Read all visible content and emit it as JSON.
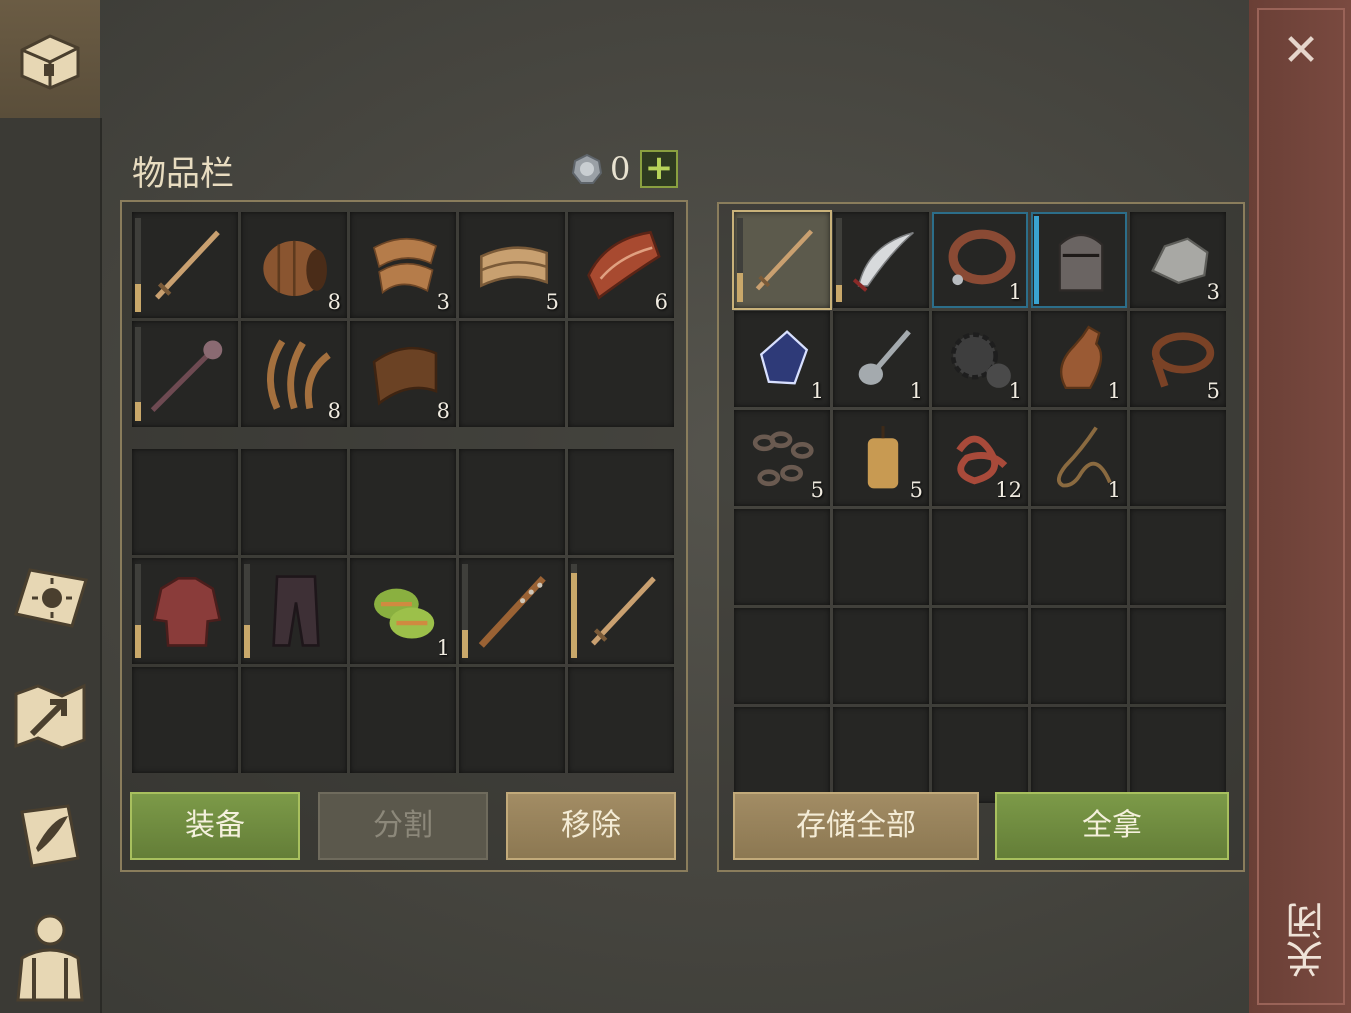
{
  "title": "物品栏",
  "currency": {
    "icon": "silver-coin-icon",
    "count": "0",
    "add_label": "+"
  },
  "inventory_top": [
    {
      "icon": "sword",
      "qty": "",
      "durability": 0.3
    },
    {
      "icon": "barrel",
      "qty": "8"
    },
    {
      "icon": "cloth-roll",
      "qty": "3"
    },
    {
      "icon": "leather-roll",
      "qty": "5"
    },
    {
      "icon": "raw-meat",
      "qty": "6"
    },
    {
      "icon": "mace-spear",
      "qty": "",
      "durability": 0.2
    },
    {
      "icon": "fiber",
      "qty": "8"
    },
    {
      "icon": "hide",
      "qty": "8"
    },
    {
      "icon": "",
      "qty": ""
    },
    {
      "icon": "",
      "qty": ""
    }
  ],
  "inventory_bottom": [
    {
      "icon": "",
      "qty": ""
    },
    {
      "icon": "",
      "qty": ""
    },
    {
      "icon": "",
      "qty": ""
    },
    {
      "icon": "",
      "qty": ""
    },
    {
      "icon": "",
      "qty": ""
    },
    {
      "icon": "chainmail",
      "qty": "",
      "durability": 0.35
    },
    {
      "icon": "trousers",
      "qty": "",
      "durability": 0.35
    },
    {
      "icon": "bandage",
      "qty": "1"
    },
    {
      "icon": "spiked-club",
      "qty": "",
      "durability": 0.3
    },
    {
      "icon": "sword",
      "qty": "",
      "durability": 0.9
    },
    {
      "icon": "",
      "qty": ""
    },
    {
      "icon": "",
      "qty": ""
    },
    {
      "icon": "",
      "qty": ""
    },
    {
      "icon": "",
      "qty": ""
    },
    {
      "icon": "",
      "qty": ""
    }
  ],
  "buttons_left": {
    "equip": "装备",
    "split": "分割",
    "remove": "移除"
  },
  "storage": [
    {
      "icon": "sword",
      "qty": "",
      "durability": 0.35,
      "selected": true
    },
    {
      "icon": "scimitar",
      "qty": "",
      "durability": 0.2
    },
    {
      "icon": "collar",
      "qty": "1",
      "blue": true
    },
    {
      "icon": "helmet",
      "qty": "",
      "blue": true,
      "bluebar": true
    },
    {
      "icon": "stone",
      "qty": "3"
    },
    {
      "icon": "crystal",
      "qty": "1"
    },
    {
      "icon": "spoon",
      "qty": "1"
    },
    {
      "icon": "gears",
      "qty": "1"
    },
    {
      "icon": "bottle",
      "qty": "1"
    },
    {
      "icon": "belt",
      "qty": "5"
    },
    {
      "icon": "chain",
      "qty": "5"
    },
    {
      "icon": "candle",
      "qty": "5"
    },
    {
      "icon": "guts",
      "qty": "12"
    },
    {
      "icon": "rope",
      "qty": "1"
    },
    {
      "icon": "",
      "qty": ""
    },
    {
      "icon": "",
      "qty": ""
    },
    {
      "icon": "",
      "qty": ""
    },
    {
      "icon": "",
      "qty": ""
    },
    {
      "icon": "",
      "qty": ""
    },
    {
      "icon": "",
      "qty": ""
    },
    {
      "icon": "",
      "qty": ""
    },
    {
      "icon": "",
      "qty": ""
    },
    {
      "icon": "",
      "qty": ""
    },
    {
      "icon": "",
      "qty": ""
    },
    {
      "icon": "",
      "qty": ""
    },
    {
      "icon": "",
      "qty": ""
    },
    {
      "icon": "",
      "qty": ""
    },
    {
      "icon": "",
      "qty": ""
    },
    {
      "icon": "",
      "qty": ""
    },
    {
      "icon": "",
      "qty": ""
    }
  ],
  "buttons_right": {
    "store_all": "存储全部",
    "take_all": "全拿"
  },
  "close": {
    "x": "✕",
    "label": "关闭"
  },
  "sidebar": [
    "chest-icon",
    "sun-journal-icon",
    "map-icon",
    "scroll-quill-icon",
    "character-backpack-icon"
  ],
  "colors": {
    "accent_green": "#7c9a48",
    "tan": "#a28c64",
    "panel_border": "#8a7d5c",
    "close_bar": "#7a4a40"
  }
}
